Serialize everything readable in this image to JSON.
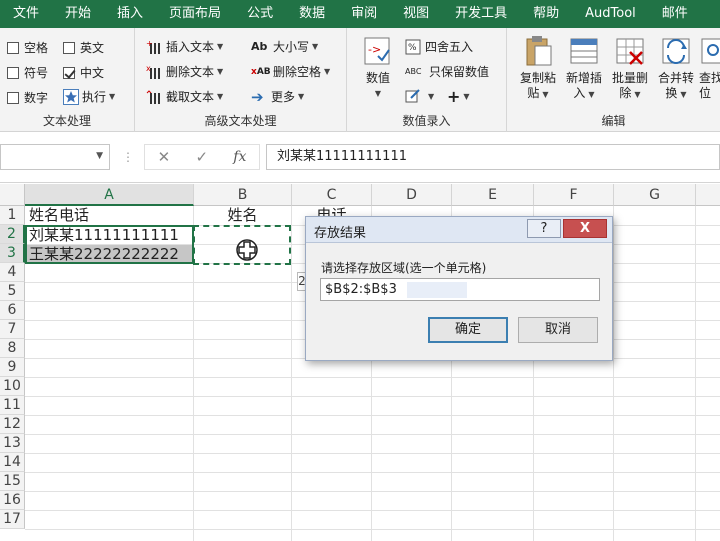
{
  "menu": {
    "tabs": [
      "文件",
      "开始",
      "插入",
      "页面布局",
      "公式",
      "数据",
      "审阅",
      "视图",
      "开发工具",
      "帮助",
      "AudTool",
      "邮件"
    ]
  },
  "ribbon": {
    "text_group": {
      "label": "文本处理",
      "checkboxes": [
        {
          "label": "空格",
          "checked": false
        },
        {
          "label": "英文",
          "checked": false
        },
        {
          "label": "符号",
          "checked": false
        },
        {
          "label": "中文",
          "checked": true
        },
        {
          "label": "数字",
          "checked": false
        },
        {
          "label": "执行",
          "checked": false
        }
      ]
    },
    "advanced_group": {
      "label": "高级文本处理",
      "commands": [
        "插入文本",
        "删除文本",
        "截取文本",
        "大小写",
        "删除空格",
        "更多"
      ]
    },
    "number_group": {
      "label": "数值录入",
      "big_button": "数值",
      "commands": [
        "四舍五入",
        "只保留数值"
      ]
    },
    "edit_group": {
      "label": "编辑",
      "buttons": [
        {
          "line1": "复制粘",
          "line2": "贴"
        },
        {
          "line1": "新增插",
          "line2": "入"
        },
        {
          "line1": "批量删",
          "line2": "除"
        },
        {
          "line1": "合并转",
          "line2": "换"
        },
        {
          "line1": "查找",
          "line2": "位"
        }
      ]
    }
  },
  "formula_bar": {
    "name_box": "",
    "fx": "fx",
    "value": "刘某某11111111111"
  },
  "sheet": {
    "columns": [
      "A",
      "B",
      "C",
      "D",
      "E",
      "F",
      "G"
    ],
    "rows": [
      "1",
      "2",
      "3",
      "4",
      "5",
      "6",
      "7",
      "8",
      "9",
      "10",
      "11",
      "12",
      "13",
      "14",
      "15",
      "16",
      "17"
    ],
    "cells": {
      "A1": "姓名电话",
      "B1": "姓名",
      "C1": "电话",
      "A2": "刘某某11111111111",
      "A3": "王某某22222222222"
    },
    "peek_text": "2"
  },
  "dialog": {
    "title": "存放结果",
    "help": "?",
    "close": "X",
    "prompt": "请选择存放区域(选一个单元格)",
    "value": "$B$2:$B$3",
    "ok": "确定",
    "cancel": "取消"
  }
}
